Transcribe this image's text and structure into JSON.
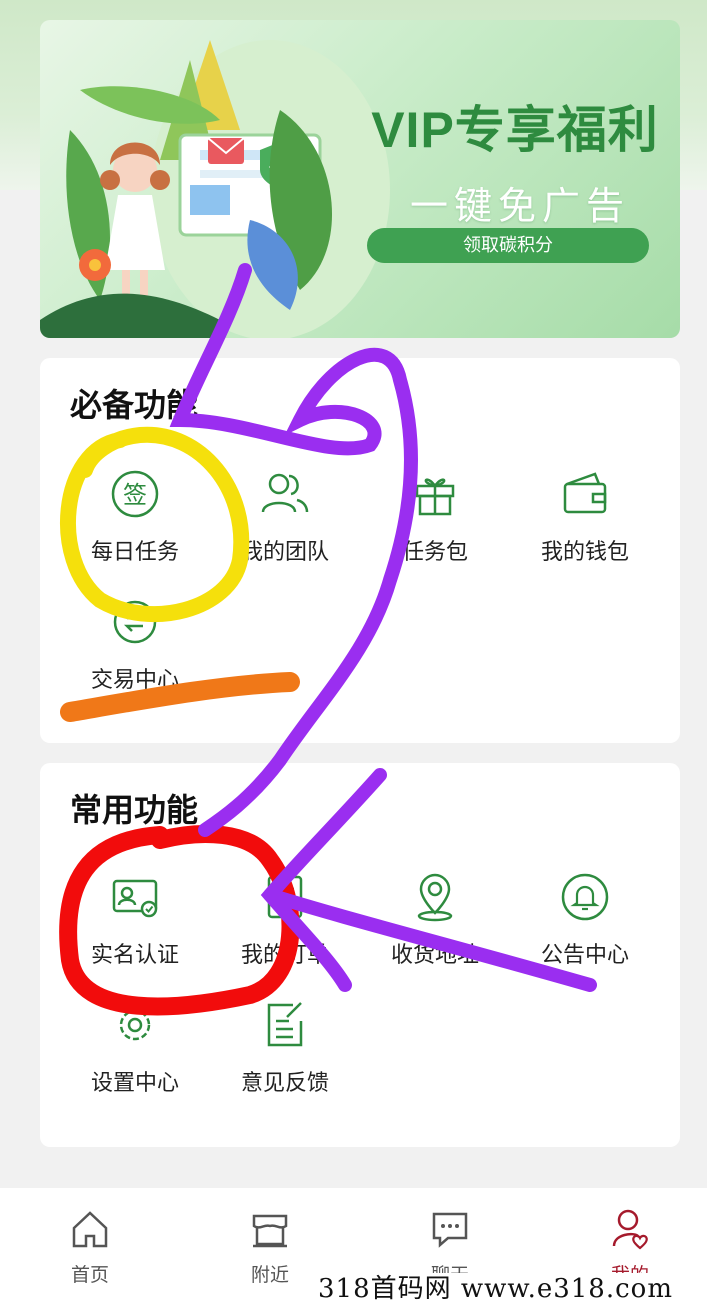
{
  "banner": {
    "title": "VIP专享福利",
    "subtitle": "一键免广告",
    "cta": "领取碳积分"
  },
  "required_section": {
    "title": "必备功能",
    "items": [
      {
        "label": "每日任务",
        "icon": "sign-in-icon",
        "glyph": "签"
      },
      {
        "label": "我的团队",
        "icon": "team-icon"
      },
      {
        "label": "任务包",
        "icon": "gift-icon"
      },
      {
        "label": "我的钱包",
        "icon": "wallet-icon"
      },
      {
        "label": "交易中心",
        "icon": "trade-icon"
      }
    ]
  },
  "common_section": {
    "title": "常用功能",
    "items": [
      {
        "label": "实名认证",
        "icon": "id-card-icon"
      },
      {
        "label": "我的订单",
        "icon": "order-icon"
      },
      {
        "label": "收货地址",
        "icon": "location-icon"
      },
      {
        "label": "公告中心",
        "icon": "bell-icon"
      },
      {
        "label": "设置中心",
        "icon": "gear-icon"
      },
      {
        "label": "意见反馈",
        "icon": "feedback-icon"
      }
    ]
  },
  "tabbar": {
    "items": [
      {
        "label": "首页",
        "icon": "home-icon"
      },
      {
        "label": "附近",
        "icon": "store-icon"
      },
      {
        "label": "聊天",
        "icon": "chat-icon"
      },
      {
        "label": "我的",
        "icon": "profile-icon",
        "active": true
      }
    ]
  },
  "watermark": "318首码网 www.e318.com",
  "colors": {
    "accent_green": "#2e8b3f",
    "active_tab": "#a51a2c",
    "annotation_yellow": "#f5e00c",
    "annotation_purple": "#9a2ef0",
    "annotation_red": "#f20c0c",
    "annotation_orange": "#f07818"
  }
}
